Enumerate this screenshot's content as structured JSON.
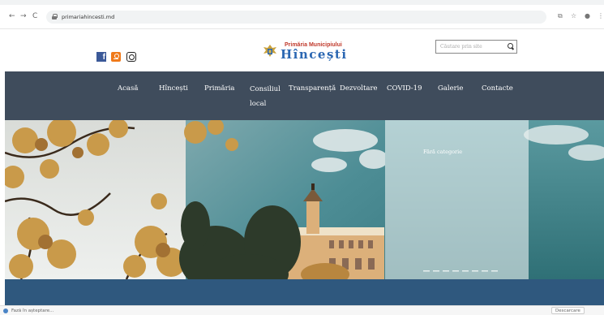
{
  "browser": {
    "back": "←",
    "forward": "→",
    "reload": "C",
    "url": "primariahincesti.md",
    "icons": [
      "translate-icon",
      "star-icon",
      "profile-icon",
      "menu-icon"
    ]
  },
  "header": {
    "social": [
      "facebook-icon",
      "odnoklassniki-icon",
      "instagram-icon"
    ],
    "facebook_glyph": "f",
    "logo_top": "Primăria Municipiului",
    "logo_name": "Hîncești",
    "search_placeholder": "Căutare prin site"
  },
  "menu": [
    {
      "label": "Acasă"
    },
    {
      "label": "Hîncești"
    },
    {
      "label": "Primăria"
    },
    {
      "label": "Consiliul local"
    },
    {
      "label": "Transparență"
    },
    {
      "label": "Dezvoltare"
    },
    {
      "label": "COVID-19"
    },
    {
      "label": "Galerie"
    },
    {
      "label": "Contacte"
    }
  ],
  "hero": {
    "caption": "Fără categorie"
  },
  "statusbar": {
    "left": "Fază în așteptare...",
    "right": "Descarcare"
  },
  "colors": {
    "nav_bg": "#3f4c5c",
    "band": "#2f587e",
    "logo_blue": "#2b67b2",
    "logo_red": "#c0392b"
  }
}
